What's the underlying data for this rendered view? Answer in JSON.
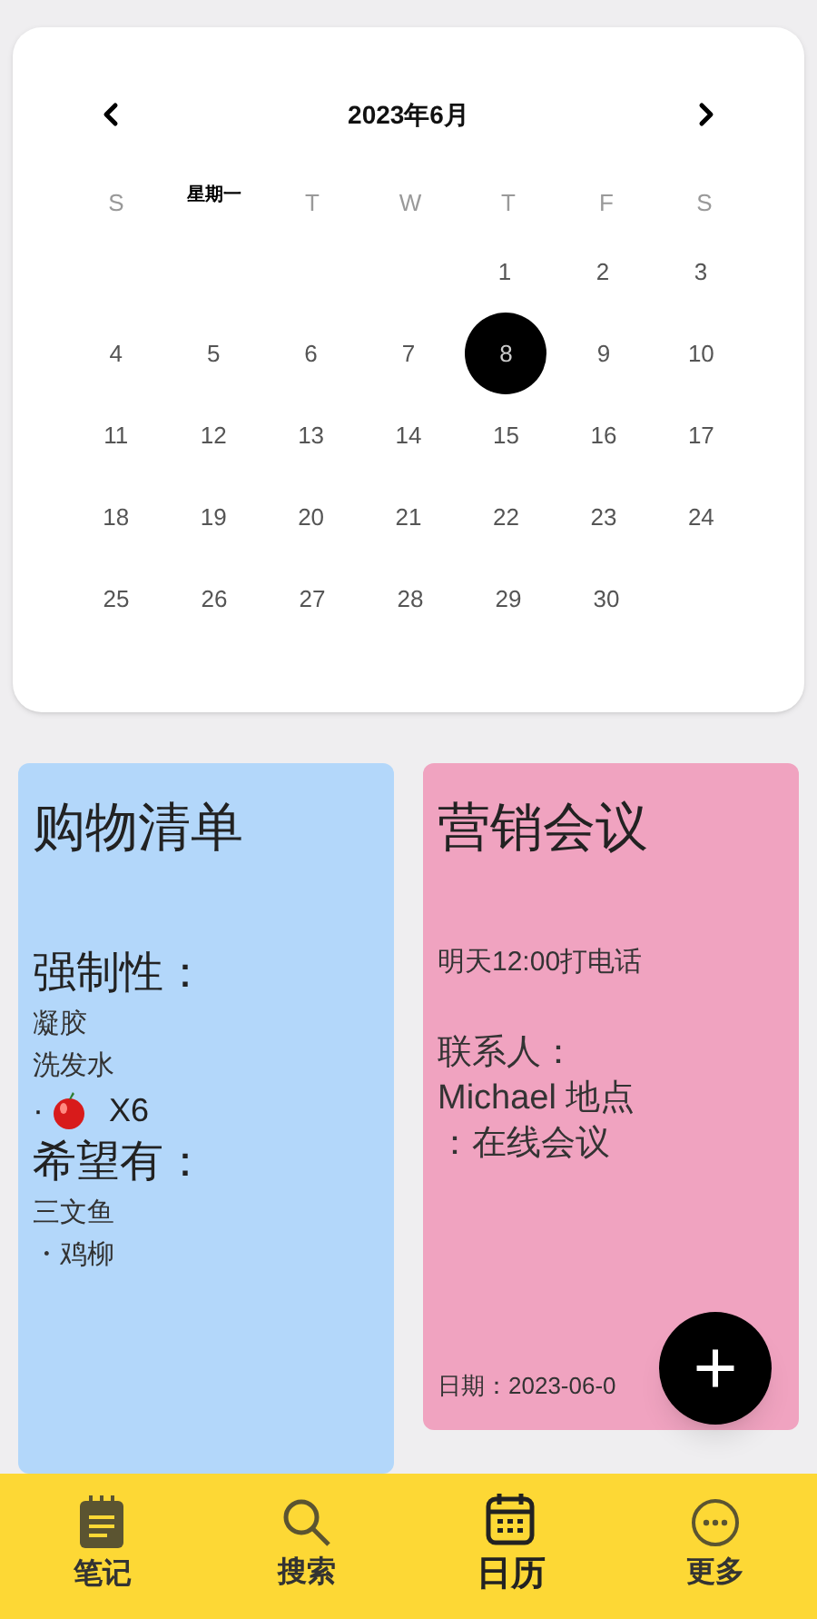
{
  "calendar": {
    "title": "2023年6月",
    "weekdays": [
      "S",
      "星期一",
      "T",
      "W",
      "T",
      "F",
      "S"
    ],
    "weeks": [
      {
        "kind": "first",
        "days": [
          {
            "day": "1",
            "selected": false
          },
          {
            "day": "2",
            "selected": false
          },
          {
            "day": "3",
            "selected": false
          }
        ]
      },
      {
        "kind": "full",
        "days": [
          {
            "day": "4",
            "selected": false
          },
          {
            "day": "5",
            "selected": false
          },
          {
            "day": "6",
            "selected": false
          },
          {
            "day": "7",
            "selected": false
          },
          {
            "day": "8",
            "selected": true
          },
          {
            "day": "9",
            "selected": false
          },
          {
            "day": "10",
            "selected": false
          }
        ]
      },
      {
        "kind": "full",
        "days": [
          {
            "day": "11",
            "selected": false
          },
          {
            "day": "12",
            "selected": false
          },
          {
            "day": "13",
            "selected": false
          },
          {
            "day": "14",
            "selected": false
          },
          {
            "day": "15",
            "selected": false
          },
          {
            "day": "16",
            "selected": false
          },
          {
            "day": "17",
            "selected": false
          }
        ]
      },
      {
        "kind": "full",
        "days": [
          {
            "day": "18",
            "selected": false
          },
          {
            "day": "19",
            "selected": false
          },
          {
            "day": "20",
            "selected": false
          },
          {
            "day": "21",
            "selected": false
          },
          {
            "day": "22",
            "selected": false
          },
          {
            "day": "23",
            "selected": false
          },
          {
            "day": "24",
            "selected": false
          }
        ]
      },
      {
        "kind": "last",
        "days": [
          {
            "day": "25",
            "selected": false
          },
          {
            "day": "26",
            "selected": false
          },
          {
            "day": "27",
            "selected": false
          },
          {
            "day": "28",
            "selected": false
          },
          {
            "day": "29",
            "selected": false
          },
          {
            "day": "30",
            "selected": false
          }
        ]
      }
    ]
  },
  "notes": [
    {
      "title": "购物清单",
      "color": "#b3d7fa",
      "lines": [
        {
          "kind": "heading",
          "text": "强制性："
        },
        {
          "kind": "item",
          "text": "凝胶"
        },
        {
          "kind": "item",
          "text": "洗发水"
        },
        {
          "kind": "apple",
          "bullet": "·",
          "text": "X6"
        },
        {
          "kind": "heading",
          "text": "希望有："
        },
        {
          "kind": "item",
          "text": "三文鱼"
        },
        {
          "kind": "item",
          "text": "・鸡柳"
        }
      ]
    },
    {
      "title": "营销会议",
      "color": "#f0a3c0",
      "lines": [
        {
          "kind": "item",
          "text": "明天12:00打电话"
        },
        {
          "kind": "label",
          "text": "联系人："
        },
        {
          "kind": "text",
          "text": "Michael 地点"
        },
        {
          "kind": "text",
          "text": "：在线会议"
        }
      ],
      "date": "日期：2023-06-0"
    }
  ],
  "fab": {
    "label": "+"
  },
  "tabs": [
    {
      "label": "笔记",
      "kind": "note",
      "selected": false
    },
    {
      "label": "搜索",
      "kind": "search",
      "selected": false
    },
    {
      "label": "日历",
      "kind": "calendar",
      "selected": true
    },
    {
      "label": "更多",
      "kind": "more",
      "selected": false
    }
  ]
}
